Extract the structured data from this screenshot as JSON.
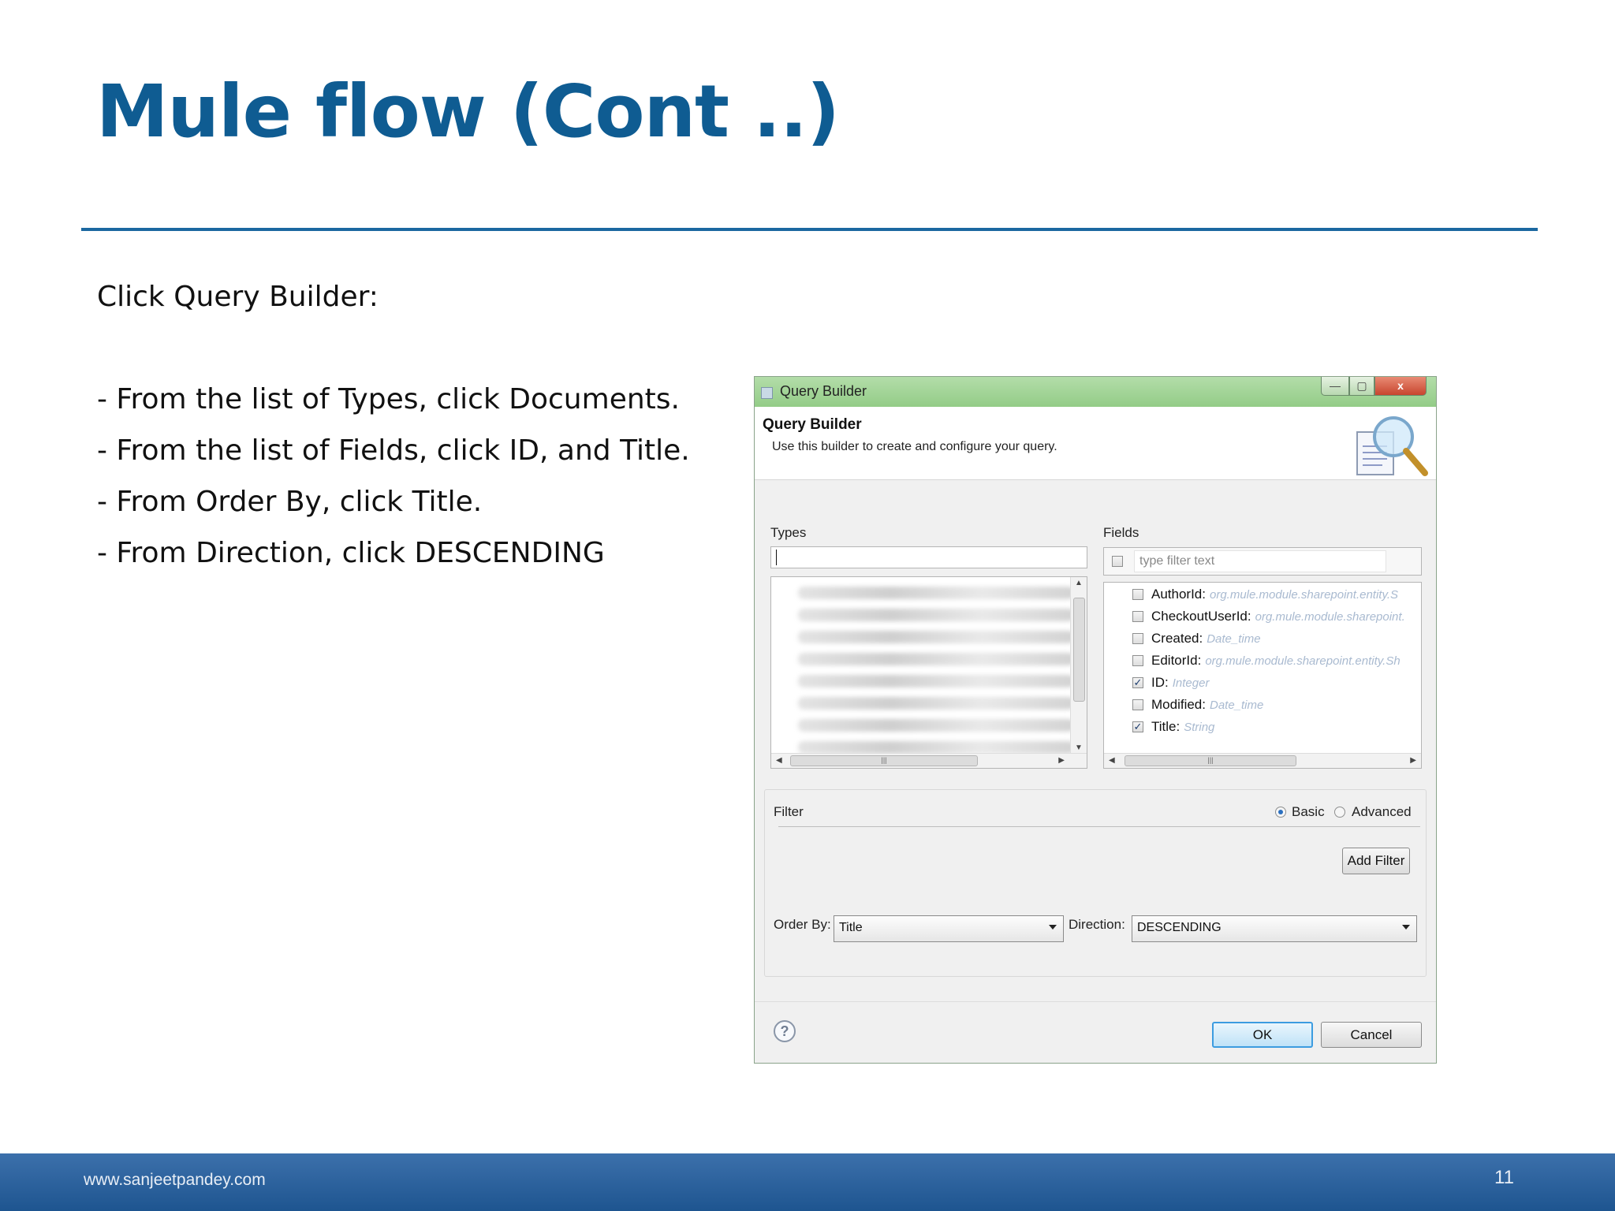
{
  "slide": {
    "title": "Mule flow (Cont ..)",
    "intro": "Click Query Builder:",
    "steps": [
      "- From the list of Types, click Documents.",
      "- From the list of Fields, click ID, and Title.",
      "- From Order By, click Title.",
      "- From Direction, click  DESCENDING"
    ],
    "footer_url": "www.sanjeetpandey.com",
    "page_number": "11",
    "colors": {
      "title": "#0f5c92",
      "footer": "#2a62a0"
    }
  },
  "dialog": {
    "window_title": "Query Builder",
    "heading": "Query Builder",
    "subheading": "Use this builder to create and configure your query.",
    "controls": {
      "minimize": "—",
      "maximize": "▢",
      "close": "x"
    },
    "types": {
      "label": "Types",
      "value": ""
    },
    "fields": {
      "label": "Fields",
      "filter_placeholder": "type filter text",
      "items": [
        {
          "name": "AuthorId:",
          "type": "org.mule.module.sharepoint.entity.S",
          "checked": false
        },
        {
          "name": "CheckoutUserId:",
          "type": "org.mule.module.sharepoint.",
          "checked": false
        },
        {
          "name": "Created:",
          "type": "Date_time",
          "checked": false
        },
        {
          "name": "EditorId:",
          "type": "org.mule.module.sharepoint.entity.Sh",
          "checked": false
        },
        {
          "name": "ID:",
          "type": "Integer",
          "checked": true
        },
        {
          "name": "Modified:",
          "type": "Date_time",
          "checked": false
        },
        {
          "name": "Title:",
          "type": "String",
          "checked": true
        }
      ]
    },
    "filter": {
      "label": "Filter",
      "basic_label": "Basic",
      "advanced_label": "Advanced",
      "mode": "Basic",
      "add_filter_label": "Add Filter"
    },
    "order_by": {
      "label": "Order By:",
      "value": "Title"
    },
    "direction": {
      "label": "Direction:",
      "value": "DESCENDING"
    },
    "help_glyph": "?",
    "ok_label": "OK",
    "cancel_label": "Cancel"
  }
}
